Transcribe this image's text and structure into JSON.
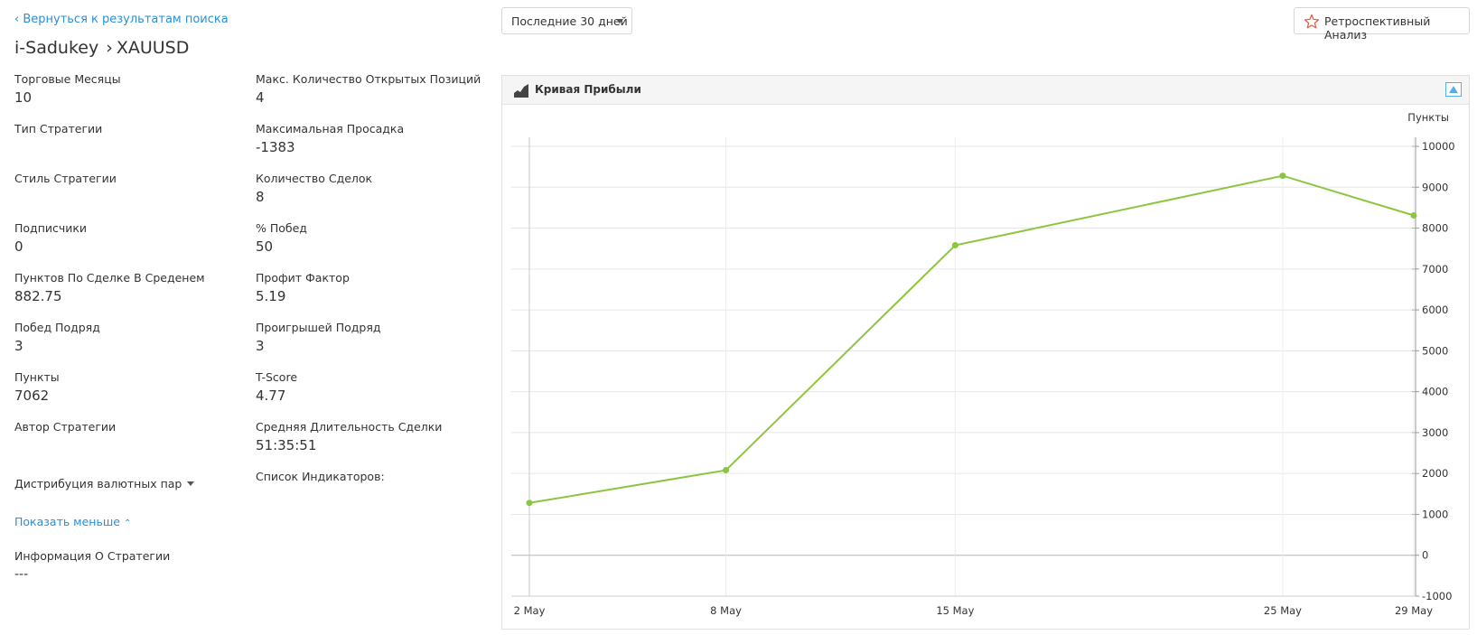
{
  "nav": {
    "back_label": "‹ Вернуться к результатам поиска"
  },
  "header": {
    "trader": "i-Sadukey",
    "separator": "›",
    "symbol": "XAUUSD"
  },
  "controls": {
    "period_selected": "Последние 30 дней",
    "retro_label": "Ретроспективный Анализ"
  },
  "stats_left": [
    {
      "label": "Торговые Месяцы",
      "value": "10"
    },
    {
      "label": "Тип Стратегии",
      "value": ""
    },
    {
      "label": "Стиль Стратегии",
      "value": ""
    },
    {
      "label": "Подписчики",
      "value": "0"
    },
    {
      "label": "Пунктов По Сделке В Среденем",
      "value": "882.75"
    },
    {
      "label": "Побед Подряд",
      "value": "3"
    },
    {
      "label": "Пункты",
      "value": "7062"
    },
    {
      "label": "Автор Стратегии",
      "value": ""
    }
  ],
  "stats_right": [
    {
      "label": "Макс. Количество Открытых Позиций",
      "value": "4"
    },
    {
      "label": "Максимальная Просадка",
      "value": "-1383"
    },
    {
      "label": "Количество Сделок",
      "value": "8"
    },
    {
      "label": "% Побед",
      "value": "50"
    },
    {
      "label": "Профит Фактор",
      "value": "5.19"
    },
    {
      "label": "Проигрышей Подряд",
      "value": "3"
    },
    {
      "label": "T-Score",
      "value": "4.77"
    },
    {
      "label": "Средняя Длительность Сделки",
      "value": "51:35:51"
    },
    {
      "label": "Список Индикаторов:",
      "value": ""
    }
  ],
  "details": {
    "distribution_label": "Дистрибуция валютных пар",
    "show_less_label": "Показать меньше",
    "info_label": "Информация О Стратегии",
    "info_value": "---"
  },
  "chart_panel": {
    "title": "Кривая Прибыли"
  },
  "colors": {
    "line": "#8cc63f",
    "link": "#2a8fd6",
    "star": "#e8553e"
  },
  "chart_data": {
    "type": "line",
    "title": "Кривая Прибыли",
    "ylabel": "Пункты",
    "categories": [
      "2 May",
      "8 May",
      "15 May",
      "25 May",
      "29 May"
    ],
    "series": [
      {
        "values": [
          1280,
          2080,
          7580,
          9280,
          8310
        ]
      }
    ],
    "ylim": [
      -1000,
      10000
    ],
    "yticks": [
      10000,
      9000,
      8000,
      7000,
      6000,
      5000,
      4000,
      3000,
      2000,
      1000,
      0,
      -1000
    ],
    "grid": true,
    "y_axis_side": "right"
  }
}
